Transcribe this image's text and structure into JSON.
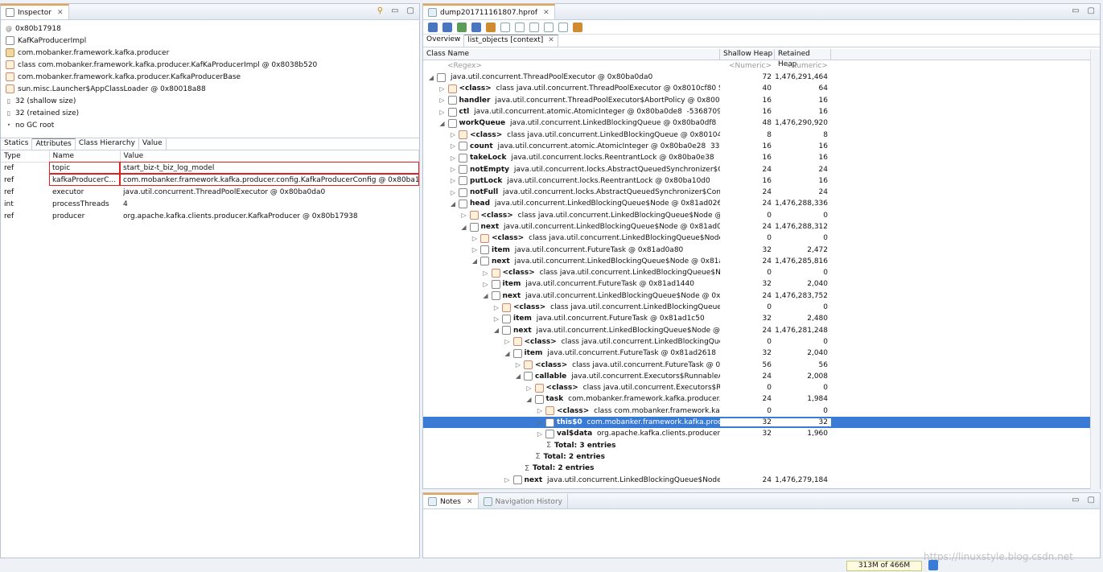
{
  "inspector": {
    "tab_label": "Inspector",
    "lines": [
      {
        "icon": "at",
        "text": "0x80b17918"
      },
      {
        "icon": "obj",
        "text": "KafKaProducerImpl"
      },
      {
        "icon": "pkg",
        "text": "com.mobanker.framework.kafka.producer"
      },
      {
        "icon": "cls",
        "text": "class com.mobanker.framework.kafka.producer.KafKaProducerImpl @ 0x8038b520"
      },
      {
        "icon": "cls",
        "text": "com.mobanker.framework.kafka.producer.KafkaProducerBase"
      },
      {
        "icon": "cls",
        "text": "sun.misc.Launcher$AppClassLoader @ 0x80018a88"
      },
      {
        "icon": "size",
        "text": "32 (shallow size)"
      },
      {
        "icon": "size",
        "text": "32 (retained size)"
      },
      {
        "icon": "dot",
        "text": "no GC root"
      }
    ],
    "subtabs": [
      "Statics",
      "Attributes",
      "Class Hierarchy",
      "Value"
    ],
    "columns": [
      "Type",
      "Name",
      "Value"
    ],
    "rows": [
      {
        "type": "ref",
        "name": "topic",
        "value": "start_biz-t_biz_log_model",
        "boxed": true
      },
      {
        "type": "ref",
        "name": "kafkaProducerC...",
        "value": "com.mobanker.framework.kafka.producer.config.KafkaProducerConfig @ 0x80ba12...",
        "boxed": true
      },
      {
        "type": "ref",
        "name": "executor",
        "value": "java.util.concurrent.ThreadPoolExecutor @ 0x80ba0da0",
        "boxed": false
      },
      {
        "type": "int",
        "name": "processThreads",
        "value": "4",
        "boxed": false
      },
      {
        "type": "ref",
        "name": "producer",
        "value": "org.apache.kafka.clients.producer.KafkaProducer @ 0x80b17938",
        "boxed": false
      }
    ]
  },
  "editor": {
    "tab_label": "dump201711161807.hprof",
    "subtabs": [
      "Overview",
      "list_objects [context]"
    ],
    "columns": [
      "Class Name",
      "Shallow Heap",
      "Retained Heap"
    ],
    "filter": {
      "name": "<Regex>",
      "shallow": "<Numeric>",
      "retained": "<Numeric>"
    },
    "rows": [
      {
        "d": 0,
        "t": "◢",
        "i": "obj",
        "b": "",
        "n": "java.util.concurrent.ThreadPoolExecutor @ 0x80ba0da0",
        "s": "72",
        "r": "1,476,291,464"
      },
      {
        "d": 1,
        "t": "▷",
        "i": "cls",
        "b": "<class>",
        "n": " class java.util.concurrent.ThreadPoolExecutor @ 0x8010cf80 System C",
        "s": "40",
        "r": "64"
      },
      {
        "d": 1,
        "t": "▷",
        "i": "field",
        "b": "handler",
        "n": " java.util.concurrent.ThreadPoolExecutor$AbortPolicy @ 0x80034678",
        "s": "16",
        "r": "16"
      },
      {
        "d": 1,
        "t": "▷",
        "i": "field",
        "b": "ctl",
        "n": " java.util.concurrent.atomic.AtomicInteger @ 0x80ba0de8  -536870908",
        "s": "16",
        "r": "16"
      },
      {
        "d": 1,
        "t": "◢",
        "i": "field",
        "b": "workQueue",
        "n": " java.util.concurrent.LinkedBlockingQueue @ 0x80ba0df8",
        "s": "48",
        "r": "1,476,290,920"
      },
      {
        "d": 2,
        "t": "▷",
        "i": "cls",
        "b": "<class>",
        "n": " class java.util.concurrent.LinkedBlockingQueue @ 0x80104f30 Syst",
        "s": "8",
        "r": "8"
      },
      {
        "d": 2,
        "t": "▷",
        "i": "field",
        "b": "count",
        "n": " java.util.concurrent.atomic.AtomicInteger @ 0x80ba0e28  338892",
        "s": "16",
        "r": "16"
      },
      {
        "d": 2,
        "t": "▷",
        "i": "field",
        "b": "takeLock",
        "n": " java.util.concurrent.locks.ReentrantLock @ 0x80ba0e38",
        "s": "16",
        "r": "16"
      },
      {
        "d": 2,
        "t": "▷",
        "i": "field",
        "b": "notEmpty",
        "n": " java.util.concurrent.locks.AbstractQueuedSynchronizer$Condition",
        "s": "24",
        "r": "24"
      },
      {
        "d": 2,
        "t": "▷",
        "i": "field",
        "b": "putLock",
        "n": " java.util.concurrent.locks.ReentrantLock @ 0x80ba10d0",
        "s": "16",
        "r": "16"
      },
      {
        "d": 2,
        "t": "▷",
        "i": "field",
        "b": "notFull",
        "n": " java.util.concurrent.locks.AbstractQueuedSynchronizer$ConditionOl",
        "s": "24",
        "r": "24"
      },
      {
        "d": 2,
        "t": "◢",
        "i": "field",
        "b": "head",
        "n": " java.util.concurrent.LinkedBlockingQueue$Node @ 0x81ad0260",
        "s": "24",
        "r": "1,476,288,336"
      },
      {
        "d": 3,
        "t": "▷",
        "i": "cls",
        "b": "<class>",
        "n": " class java.util.concurrent.LinkedBlockingQueue$Node @ 0x801",
        "s": "0",
        "r": "0"
      },
      {
        "d": 3,
        "t": "◢",
        "i": "field",
        "b": "next",
        "n": " java.util.concurrent.LinkedBlockingQueue$Node @ 0x81ad0a68",
        "s": "24",
        "r": "1,476,288,312"
      },
      {
        "d": 4,
        "t": "▷",
        "i": "cls",
        "b": "<class>",
        "n": " class java.util.concurrent.LinkedBlockingQueue$Node @ 0x8",
        "s": "0",
        "r": "0"
      },
      {
        "d": 4,
        "t": "▷",
        "i": "field",
        "b": "item",
        "n": " java.util.concurrent.FutureTask @ 0x81ad0a80",
        "s": "32",
        "r": "2,472"
      },
      {
        "d": 4,
        "t": "◢",
        "i": "field",
        "b": "next",
        "n": " java.util.concurrent.LinkedBlockingQueue$Node @ 0x81ad1428",
        "s": "24",
        "r": "1,476,285,816"
      },
      {
        "d": 5,
        "t": "▷",
        "i": "cls",
        "b": "<class>",
        "n": " class java.util.concurrent.LinkedBlockingQueue$Node @ 0",
        "s": "0",
        "r": "0"
      },
      {
        "d": 5,
        "t": "▷",
        "i": "field",
        "b": "item",
        "n": " java.util.concurrent.FutureTask @ 0x81ad1440",
        "s": "32",
        "r": "2,040"
      },
      {
        "d": 5,
        "t": "◢",
        "i": "field",
        "b": "next",
        "n": " java.util.concurrent.LinkedBlockingQueue$Node @ 0x81ad1",
        "s": "24",
        "r": "1,476,283,752"
      },
      {
        "d": 6,
        "t": "▷",
        "i": "cls",
        "b": "<class>",
        "n": " class java.util.concurrent.LinkedBlockingQueue$Node",
        "s": "0",
        "r": "0"
      },
      {
        "d": 6,
        "t": "▷",
        "i": "field",
        "b": "item",
        "n": " java.util.concurrent.FutureTask @ 0x81ad1c50",
        "s": "32",
        "r": "2,480"
      },
      {
        "d": 6,
        "t": "◢",
        "i": "field",
        "b": "next",
        "n": " java.util.concurrent.LinkedBlockingQueue$Node @ 0x81a",
        "s": "24",
        "r": "1,476,281,248"
      },
      {
        "d": 7,
        "t": "▷",
        "i": "cls",
        "b": "<class>",
        "n": " class java.util.concurrent.LinkedBlockingQueue$No",
        "s": "0",
        "r": "0"
      },
      {
        "d": 7,
        "t": "◢",
        "i": "field",
        "b": "item",
        "n": " java.util.concurrent.FutureTask @ 0x81ad2618",
        "s": "32",
        "r": "2,040"
      },
      {
        "d": 8,
        "t": "▷",
        "i": "cls",
        "b": "<class>",
        "n": " class java.util.concurrent.FutureTask @ 0x8039",
        "s": "56",
        "r": "56"
      },
      {
        "d": 8,
        "t": "◢",
        "i": "field",
        "b": "callable",
        "n": " java.util.concurrent.Executors$RunnableAdapte",
        "s": "24",
        "r": "2,008"
      },
      {
        "d": 9,
        "t": "▷",
        "i": "cls",
        "b": "<class>",
        "n": " class java.util.concurrent.Executors$Runnab",
        "s": "0",
        "r": "0"
      },
      {
        "d": 9,
        "t": "◢",
        "i": "field",
        "b": "task",
        "n": " com.mobanker.framework.kafka.producer.Kafk",
        "s": "24",
        "r": "1,984"
      },
      {
        "d": 10,
        "t": "▷",
        "i": "cls",
        "b": "<class>",
        "n": " class com.mobanker.framework.kafka.p",
        "s": "0",
        "r": "0"
      },
      {
        "d": 10,
        "t": "▷",
        "i": "field",
        "b": "this$0",
        "n": " com.mobanker.framework.kafka.produce",
        "s": "32",
        "r": "32",
        "sel": true
      },
      {
        "d": 10,
        "t": "▷",
        "i": "field",
        "b": "val$data",
        "n": " org.apache.kafka.clients.producer.Prod",
        "s": "32",
        "r": "1,960"
      },
      {
        "d": 10,
        "t": "",
        "i": "sum",
        "b": "Total: 3 entries",
        "n": "",
        "s": "",
        "r": ""
      },
      {
        "d": 9,
        "t": "",
        "i": "sum",
        "b": "Total: 2 entries",
        "n": "",
        "s": "",
        "r": ""
      },
      {
        "d": 8,
        "t": "",
        "i": "sum",
        "b": "Total: 2 entries",
        "n": "",
        "s": "",
        "r": ""
      },
      {
        "d": 7,
        "t": "▷",
        "i": "field",
        "b": "next",
        "n": " java.util.concurrent.LinkedBlockingQueue$Node @ 0x",
        "s": "24",
        "r": "1,476,279,184"
      }
    ]
  },
  "notes": {
    "tabs": [
      "Notes",
      "Navigation History"
    ]
  },
  "status": {
    "heap": "313M of 466M"
  },
  "watermark": "https://linuxstyle.blog.csdn.net"
}
